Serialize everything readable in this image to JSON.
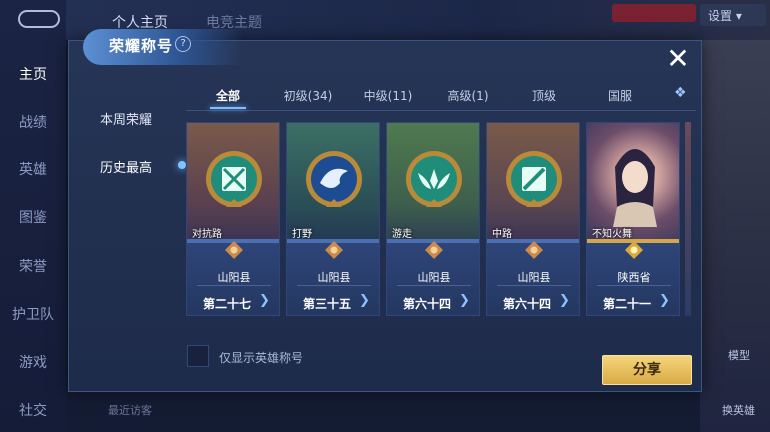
{
  "background": {
    "top_tabs": [
      "个人主页",
      "电竞主题"
    ],
    "settings_label": "设置",
    "left_nav": [
      "主页",
      "战绩",
      "英雄",
      "图鉴",
      "荣誉",
      "护卫队",
      "游戏",
      "社交"
    ],
    "right_labels": [
      "模型",
      "换英雄"
    ],
    "bottom_hint": "最近访客"
  },
  "modal": {
    "title": "荣耀称号",
    "help_glyph": "?",
    "close_glyph": "✕",
    "side_tabs": [
      "本周荣耀",
      "历史最高"
    ],
    "filter_tabs": [
      "全部",
      "初级(34)",
      "中级(11)",
      "高级(1)",
      "顶级",
      "国服"
    ],
    "cards": [
      {
        "role": "对抗路",
        "region": "山阳县",
        "rank": "第二十七"
      },
      {
        "role": "打野",
        "region": "山阳县",
        "rank": "第三十五"
      },
      {
        "role": "游走",
        "region": "山阳县",
        "rank": "第六十四"
      },
      {
        "role": "中路",
        "region": "山阳县",
        "rank": "第六十四"
      },
      {
        "role": "不知火舞",
        "region": "陕西省",
        "rank": "第二十一"
      }
    ],
    "checkbox_label": "仅显示英雄称号",
    "share_label": "分享"
  },
  "colors": {
    "accent_blue": "#7fbfff",
    "share_gold": "#e2b956"
  }
}
